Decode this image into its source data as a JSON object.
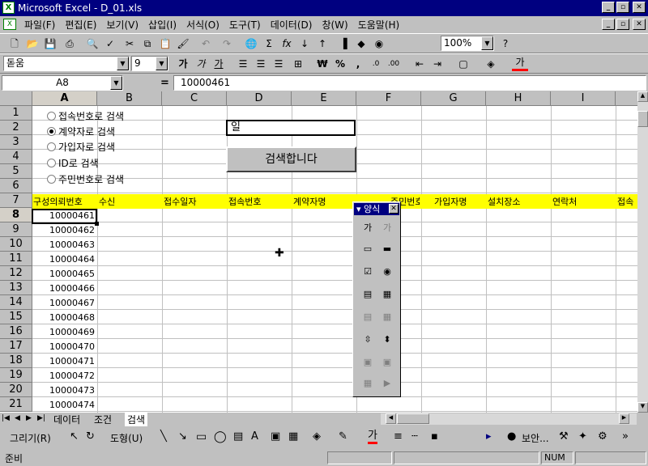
{
  "window": {
    "title": "Microsoft Excel - D_01.xls",
    "min": "_",
    "restore": "▫",
    "close": "✕"
  },
  "menu": [
    "파일(F)",
    "편집(E)",
    "보기(V)",
    "삽입(I)",
    "서식(O)",
    "도구(T)",
    "데이터(D)",
    "창(W)",
    "도움말(H)"
  ],
  "toolbar": {
    "zoom": "100%",
    "font": "돋움",
    "size": "9",
    "bold": "가",
    "italic": "가",
    "underline": "가",
    "currency": "₩",
    "percent": "%",
    "comma": ","
  },
  "formula": {
    "name_box": "A8",
    "equals": "=",
    "value": "10000461"
  },
  "columns": [
    "A",
    "B",
    "C",
    "D",
    "E",
    "F",
    "G",
    "H",
    "I"
  ],
  "rows": [
    "1",
    "2",
    "3",
    "4",
    "5",
    "6",
    "7",
    "8",
    "9",
    "10",
    "11",
    "12",
    "13",
    "14",
    "15",
    "16",
    "17",
    "18",
    "19",
    "20",
    "21"
  ],
  "radios": [
    {
      "label": "접속번호로 검색",
      "checked": false
    },
    {
      "label": "계약자로 검색",
      "checked": true
    },
    {
      "label": "가입자로 검색",
      "checked": false
    },
    {
      "label": "ID로 검색",
      "checked": false
    },
    {
      "label": "주민번호로 검색",
      "checked": false
    }
  ],
  "search": {
    "input_value": "일",
    "button": "검색합니다"
  },
  "headers": [
    "구성의뢰번호",
    "수신",
    "접수일자",
    "접속번호",
    "계약자명",
    "주민번호",
    "가입자명",
    "설치장소",
    "연락처",
    "접속"
  ],
  "ids": [
    "10000461",
    "10000462",
    "10000463",
    "10000464",
    "10000465",
    "10000466",
    "10000467",
    "10000468",
    "10000469",
    "10000470",
    "10000471",
    "10000472",
    "10000473",
    "10000474"
  ],
  "forms_toolbar": {
    "title": "양식",
    "close": "✕"
  },
  "sheets": [
    "데이터",
    "조건",
    "검색"
  ],
  "drawing": {
    "draw": "그리기(R)",
    "autoshape": "도형(U)",
    "security": "보안..."
  },
  "status": {
    "ready": "준비",
    "num": "NUM"
  },
  "colors": {
    "title_bg": "#000080",
    "header_yellow": "#ffff00",
    "face": "#c0c0c0"
  }
}
